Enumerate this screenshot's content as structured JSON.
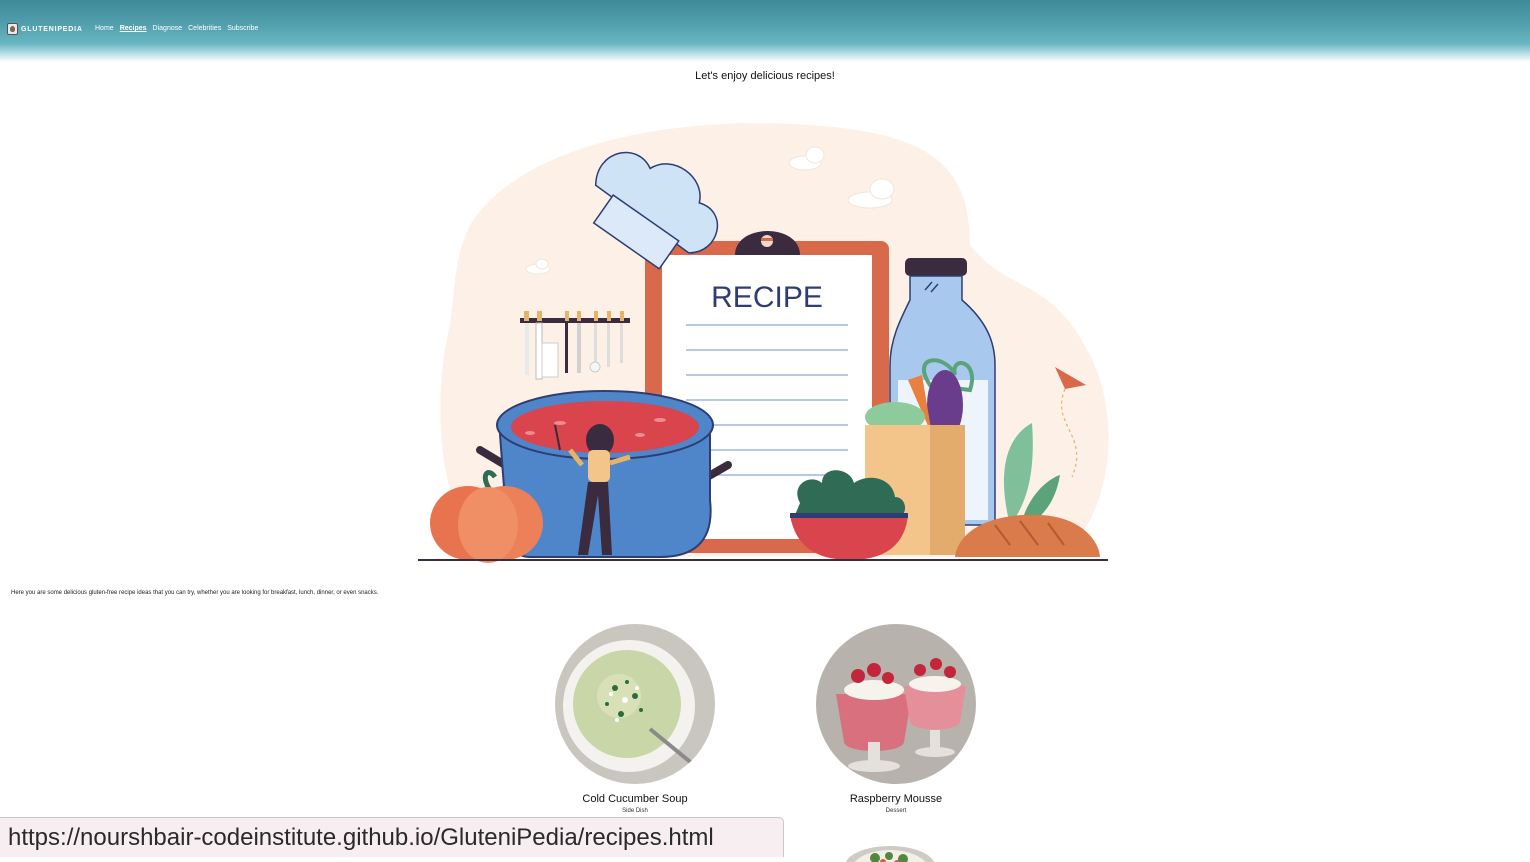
{
  "header": {
    "brand_name": "GluteniPedia",
    "nav": [
      {
        "label": "Home",
        "active": false
      },
      {
        "label": "Recipes",
        "active": true
      },
      {
        "label": "Diagnose",
        "active": false
      },
      {
        "label": "Celebrities",
        "active": false
      },
      {
        "label": "Subscribe",
        "active": false
      }
    ]
  },
  "intro": "Let's enjoy delicious recipes!",
  "hero": {
    "board_title": "RECIPE"
  },
  "lead_text": "Here you are some delicious gluten-free recipe ideas that you can try, whether you are looking for breakfast, lunch, dinner, or even snacks.",
  "recipes": [
    {
      "title": "Cold Cucumber Soup",
      "category": "Side Dish"
    },
    {
      "title": "Raspberry Mousse",
      "category": "Dessert"
    }
  ],
  "status_bar": {
    "url": "https://nourshbair-codeinstitute.github.io/GluteniPedia/recipes.html"
  },
  "colors": {
    "header_top": "#3f8a99",
    "header_mid": "#68b6c2",
    "hero_blob": "#fdf1e7",
    "clipboard": "#d8694b",
    "pot": "#4f86c9",
    "soup": "#d9444d"
  }
}
